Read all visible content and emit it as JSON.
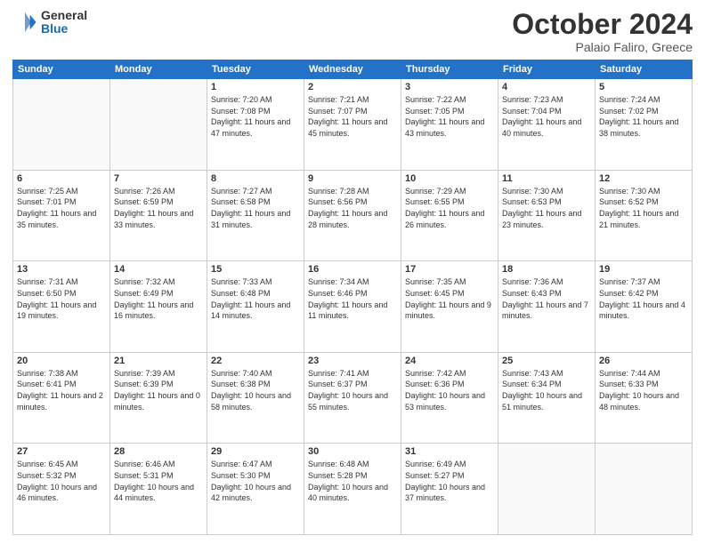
{
  "logo": {
    "general": "General",
    "blue": "Blue"
  },
  "title": {
    "month": "October 2024",
    "location": "Palaio Faliro, Greece"
  },
  "weekdays": [
    "Sunday",
    "Monday",
    "Tuesday",
    "Wednesday",
    "Thursday",
    "Friday",
    "Saturday"
  ],
  "weeks": [
    [
      {
        "day": "",
        "info": ""
      },
      {
        "day": "",
        "info": ""
      },
      {
        "day": "1",
        "info": "Sunrise: 7:20 AM\nSunset: 7:08 PM\nDaylight: 11 hours and 47 minutes."
      },
      {
        "day": "2",
        "info": "Sunrise: 7:21 AM\nSunset: 7:07 PM\nDaylight: 11 hours and 45 minutes."
      },
      {
        "day": "3",
        "info": "Sunrise: 7:22 AM\nSunset: 7:05 PM\nDaylight: 11 hours and 43 minutes."
      },
      {
        "day": "4",
        "info": "Sunrise: 7:23 AM\nSunset: 7:04 PM\nDaylight: 11 hours and 40 minutes."
      },
      {
        "day": "5",
        "info": "Sunrise: 7:24 AM\nSunset: 7:02 PM\nDaylight: 11 hours and 38 minutes."
      }
    ],
    [
      {
        "day": "6",
        "info": "Sunrise: 7:25 AM\nSunset: 7:01 PM\nDaylight: 11 hours and 35 minutes."
      },
      {
        "day": "7",
        "info": "Sunrise: 7:26 AM\nSunset: 6:59 PM\nDaylight: 11 hours and 33 minutes."
      },
      {
        "day": "8",
        "info": "Sunrise: 7:27 AM\nSunset: 6:58 PM\nDaylight: 11 hours and 31 minutes."
      },
      {
        "day": "9",
        "info": "Sunrise: 7:28 AM\nSunset: 6:56 PM\nDaylight: 11 hours and 28 minutes."
      },
      {
        "day": "10",
        "info": "Sunrise: 7:29 AM\nSunset: 6:55 PM\nDaylight: 11 hours and 26 minutes."
      },
      {
        "day": "11",
        "info": "Sunrise: 7:30 AM\nSunset: 6:53 PM\nDaylight: 11 hours and 23 minutes."
      },
      {
        "day": "12",
        "info": "Sunrise: 7:30 AM\nSunset: 6:52 PM\nDaylight: 11 hours and 21 minutes."
      }
    ],
    [
      {
        "day": "13",
        "info": "Sunrise: 7:31 AM\nSunset: 6:50 PM\nDaylight: 11 hours and 19 minutes."
      },
      {
        "day": "14",
        "info": "Sunrise: 7:32 AM\nSunset: 6:49 PM\nDaylight: 11 hours and 16 minutes."
      },
      {
        "day": "15",
        "info": "Sunrise: 7:33 AM\nSunset: 6:48 PM\nDaylight: 11 hours and 14 minutes."
      },
      {
        "day": "16",
        "info": "Sunrise: 7:34 AM\nSunset: 6:46 PM\nDaylight: 11 hours and 11 minutes."
      },
      {
        "day": "17",
        "info": "Sunrise: 7:35 AM\nSunset: 6:45 PM\nDaylight: 11 hours and 9 minutes."
      },
      {
        "day": "18",
        "info": "Sunrise: 7:36 AM\nSunset: 6:43 PM\nDaylight: 11 hours and 7 minutes."
      },
      {
        "day": "19",
        "info": "Sunrise: 7:37 AM\nSunset: 6:42 PM\nDaylight: 11 hours and 4 minutes."
      }
    ],
    [
      {
        "day": "20",
        "info": "Sunrise: 7:38 AM\nSunset: 6:41 PM\nDaylight: 11 hours and 2 minutes."
      },
      {
        "day": "21",
        "info": "Sunrise: 7:39 AM\nSunset: 6:39 PM\nDaylight: 11 hours and 0 minutes."
      },
      {
        "day": "22",
        "info": "Sunrise: 7:40 AM\nSunset: 6:38 PM\nDaylight: 10 hours and 58 minutes."
      },
      {
        "day": "23",
        "info": "Sunrise: 7:41 AM\nSunset: 6:37 PM\nDaylight: 10 hours and 55 minutes."
      },
      {
        "day": "24",
        "info": "Sunrise: 7:42 AM\nSunset: 6:36 PM\nDaylight: 10 hours and 53 minutes."
      },
      {
        "day": "25",
        "info": "Sunrise: 7:43 AM\nSunset: 6:34 PM\nDaylight: 10 hours and 51 minutes."
      },
      {
        "day": "26",
        "info": "Sunrise: 7:44 AM\nSunset: 6:33 PM\nDaylight: 10 hours and 48 minutes."
      }
    ],
    [
      {
        "day": "27",
        "info": "Sunrise: 6:45 AM\nSunset: 5:32 PM\nDaylight: 10 hours and 46 minutes."
      },
      {
        "day": "28",
        "info": "Sunrise: 6:46 AM\nSunset: 5:31 PM\nDaylight: 10 hours and 44 minutes."
      },
      {
        "day": "29",
        "info": "Sunrise: 6:47 AM\nSunset: 5:30 PM\nDaylight: 10 hours and 42 minutes."
      },
      {
        "day": "30",
        "info": "Sunrise: 6:48 AM\nSunset: 5:28 PM\nDaylight: 10 hours and 40 minutes."
      },
      {
        "day": "31",
        "info": "Sunrise: 6:49 AM\nSunset: 5:27 PM\nDaylight: 10 hours and 37 minutes."
      },
      {
        "day": "",
        "info": ""
      },
      {
        "day": "",
        "info": ""
      }
    ]
  ]
}
